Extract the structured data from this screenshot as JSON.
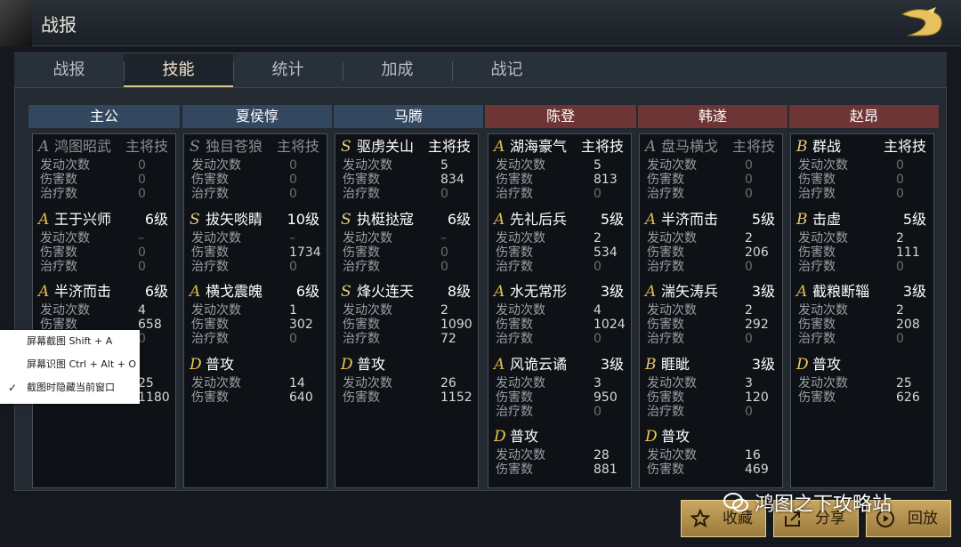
{
  "header": {
    "title": "战报"
  },
  "tabs": [
    {
      "label": "战报"
    },
    {
      "label": "技能"
    },
    {
      "label": "统计"
    },
    {
      "label": "加成"
    },
    {
      "label": "战记"
    }
  ],
  "generals": [
    {
      "name": "主公",
      "side": "blue",
      "skills": [
        {
          "grade": "A",
          "name": "鸿图昭武",
          "level": "主将技",
          "dim": true,
          "rows": [
            [
              "发动次数",
              "0"
            ],
            [
              "伤害数",
              "0"
            ],
            [
              "治疗数",
              "0"
            ]
          ]
        },
        {
          "grade": "A",
          "name": "王于兴师",
          "level": "6级",
          "rows": [
            [
              "发动次数",
              "–"
            ],
            [
              "伤害数",
              "0"
            ],
            [
              "治疗数",
              "0"
            ]
          ]
        },
        {
          "grade": "A",
          "name": "半济而击",
          "level": "6级",
          "rows": [
            [
              "发动次数",
              "4"
            ],
            [
              "伤害数",
              "658"
            ],
            [
              "治疗数",
              "0"
            ]
          ]
        },
        {
          "grade": "D",
          "name": "普攻",
          "level": "",
          "rows": [
            [
              "发动次数",
              "25"
            ],
            [
              "伤害数",
              "1180"
            ]
          ]
        }
      ]
    },
    {
      "name": "夏侯惇",
      "side": "blue",
      "skills": [
        {
          "grade": "S",
          "name": "独目苍狼",
          "level": "主将技",
          "dim": true,
          "rows": [
            [
              "发动次数",
              "0"
            ],
            [
              "伤害数",
              "0"
            ],
            [
              "治疗数",
              "0"
            ]
          ]
        },
        {
          "grade": "S",
          "name": "拔矢啖睛",
          "level": "10级",
          "rows": [
            [
              "发动次数",
              "–"
            ],
            [
              "伤害数",
              "1734"
            ],
            [
              "治疗数",
              "0"
            ]
          ]
        },
        {
          "grade": "A",
          "name": "横戈震魄",
          "level": "6级",
          "rows": [
            [
              "发动次数",
              "1"
            ],
            [
              "伤害数",
              "302"
            ],
            [
              "治疗数",
              "0"
            ]
          ]
        },
        {
          "grade": "D",
          "name": "普攻",
          "level": "",
          "rows": [
            [
              "发动次数",
              "14"
            ],
            [
              "伤害数",
              "640"
            ]
          ]
        }
      ]
    },
    {
      "name": "马腾",
      "side": "blue",
      "skills": [
        {
          "grade": "S",
          "name": "驱虏关山",
          "level": "主将技",
          "rows": [
            [
              "发动次数",
              "5"
            ],
            [
              "伤害数",
              "834"
            ],
            [
              "治疗数",
              "0"
            ]
          ]
        },
        {
          "grade": "S",
          "name": "执梃挞寇",
          "level": "6级",
          "rows": [
            [
              "发动次数",
              "–"
            ],
            [
              "伤害数",
              "0"
            ],
            [
              "治疗数",
              "0"
            ]
          ]
        },
        {
          "grade": "S",
          "name": "烽火连天",
          "level": "8级",
          "rows": [
            [
              "发动次数",
              "2"
            ],
            [
              "伤害数",
              "1090"
            ],
            [
              "治疗数",
              "72"
            ]
          ]
        },
        {
          "grade": "D",
          "name": "普攻",
          "level": "",
          "rows": [
            [
              "发动次数",
              "26"
            ],
            [
              "伤害数",
              "1152"
            ]
          ]
        }
      ]
    },
    {
      "name": "陈登",
      "side": "red",
      "skills": [
        {
          "grade": "A",
          "name": "湖海豪气",
          "level": "主将技",
          "rows": [
            [
              "发动次数",
              "5"
            ],
            [
              "伤害数",
              "813"
            ],
            [
              "治疗数",
              "0"
            ]
          ]
        },
        {
          "grade": "A",
          "name": "先礼后兵",
          "level": "5级",
          "rows": [
            [
              "发动次数",
              "2"
            ],
            [
              "伤害数",
              "534"
            ],
            [
              "治疗数",
              "0"
            ]
          ]
        },
        {
          "grade": "A",
          "name": "水无常形",
          "level": "3级",
          "rows": [
            [
              "发动次数",
              "4"
            ],
            [
              "伤害数",
              "1024"
            ],
            [
              "治疗数",
              "0"
            ]
          ]
        },
        {
          "grade": "A",
          "name": "风诡云谲",
          "level": "3级",
          "rows": [
            [
              "发动次数",
              "3"
            ],
            [
              "伤害数",
              "950"
            ],
            [
              "治疗数",
              "0"
            ]
          ]
        },
        {
          "grade": "D",
          "name": "普攻",
          "level": "",
          "rows": [
            [
              "发动次数",
              "28"
            ],
            [
              "伤害数",
              "881"
            ]
          ]
        }
      ]
    },
    {
      "name": "韩遂",
      "side": "red",
      "skills": [
        {
          "grade": "A",
          "name": "盘马横戈",
          "level": "主将技",
          "dim": true,
          "rows": [
            [
              "发动次数",
              "0"
            ],
            [
              "伤害数",
              "0"
            ],
            [
              "治疗数",
              "0"
            ]
          ]
        },
        {
          "grade": "A",
          "name": "半济而击",
          "level": "5级",
          "rows": [
            [
              "发动次数",
              "2"
            ],
            [
              "伤害数",
              "206"
            ],
            [
              "治疗数",
              "0"
            ]
          ]
        },
        {
          "grade": "A",
          "name": "湍矢涛兵",
          "level": "3级",
          "rows": [
            [
              "发动次数",
              "2"
            ],
            [
              "伤害数",
              "292"
            ],
            [
              "治疗数",
              "0"
            ]
          ]
        },
        {
          "grade": "B",
          "name": "睚眦",
          "level": "3级",
          "rows": [
            [
              "发动次数",
              "3"
            ],
            [
              "伤害数",
              "120"
            ],
            [
              "治疗数",
              "0"
            ]
          ]
        },
        {
          "grade": "D",
          "name": "普攻",
          "level": "",
          "rows": [
            [
              "发动次数",
              "16"
            ],
            [
              "伤害数",
              "469"
            ]
          ]
        }
      ]
    },
    {
      "name": "赵昂",
      "side": "red",
      "skills": [
        {
          "grade": "B",
          "name": "群战",
          "level": "主将技",
          "rows": [
            [
              "发动次数",
              "0"
            ],
            [
              "伤害数",
              "0"
            ],
            [
              "治疗数",
              "0"
            ]
          ]
        },
        {
          "grade": "B",
          "name": "击虚",
          "level": "5级",
          "rows": [
            [
              "发动次数",
              "2"
            ],
            [
              "伤害数",
              "111"
            ],
            [
              "治疗数",
              "0"
            ]
          ]
        },
        {
          "grade": "A",
          "name": "截粮断辎",
          "level": "3级",
          "rows": [
            [
              "发动次数",
              "2"
            ],
            [
              "伤害数",
              "208"
            ],
            [
              "治疗数",
              "0"
            ]
          ]
        },
        {
          "grade": "D",
          "name": "普攻",
          "level": "",
          "rows": [
            [
              "发动次数",
              "25"
            ],
            [
              "伤害数",
              "626"
            ]
          ]
        }
      ]
    }
  ],
  "buttons": {
    "collect": "收藏",
    "share": "分享",
    "replay": "回放"
  },
  "context_menu": [
    {
      "label": "屏幕截图 Shift + A",
      "checked": false
    },
    {
      "label": "屏幕识图 Ctrl + Alt + O",
      "checked": false
    },
    {
      "label": "截图时隐藏当前窗口",
      "checked": true
    }
  ],
  "watermark": "鸿图之下攻略站",
  "colors": {
    "accent": "#d8c48a",
    "blue_header": "#33485f",
    "red_header": "#6e3536",
    "button_gold": "#c9a660"
  }
}
